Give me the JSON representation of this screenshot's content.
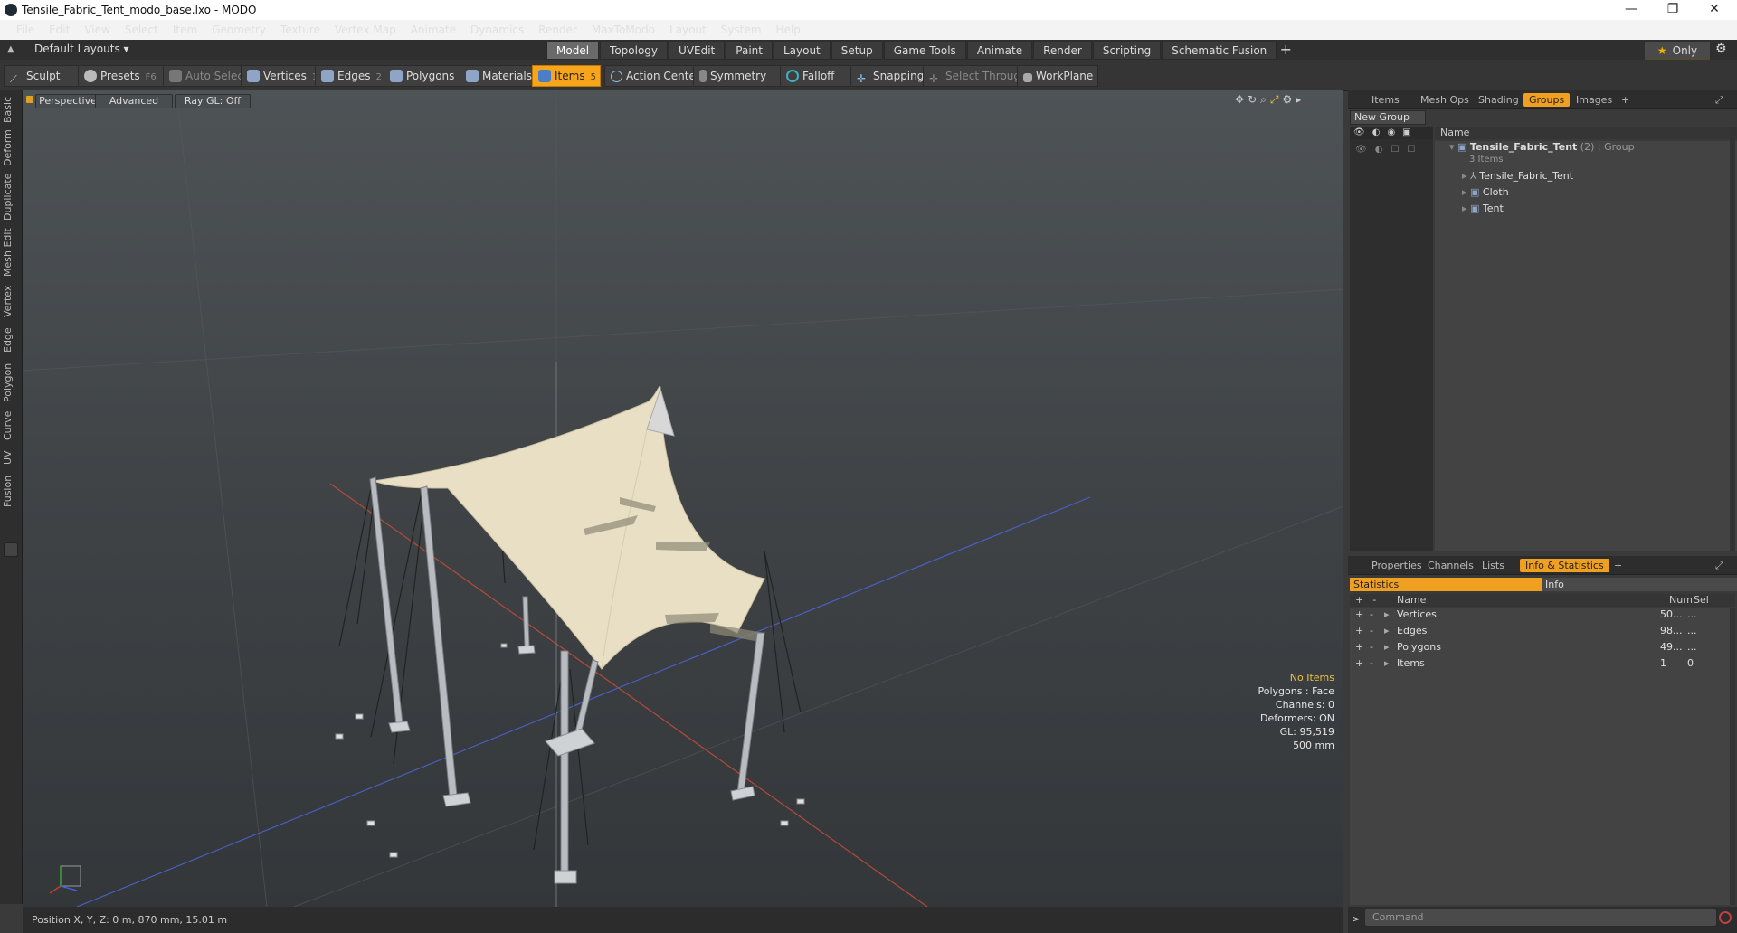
{
  "window": {
    "title": "Tensile_Fabric_Tent_modo_base.lxo - MODO",
    "controls": [
      "—",
      "❐",
      "✕"
    ]
  },
  "menu": [
    "File",
    "Edit",
    "View",
    "Select",
    "Item",
    "Geometry",
    "Texture",
    "Vertex Map",
    "Animate",
    "Dynamics",
    "Render",
    "MaxToModo",
    "Layout",
    "System",
    "Help"
  ],
  "layouts": {
    "label": "Default Layouts ▾",
    "tabs": [
      "Model",
      "Topology",
      "UVEdit",
      "Paint",
      "Layout",
      "Setup",
      "Game Tools",
      "Animate",
      "Render",
      "Scripting",
      "Schematic Fusion"
    ],
    "active_tab": "Model",
    "add": "+",
    "only": "Only"
  },
  "toolbar": {
    "sculpt": "Sculpt",
    "presets": "Presets",
    "presets_key": "F6",
    "auto_select": "Auto Select",
    "vertices": "Vertices",
    "vertices_key": "1",
    "edges": "Edges",
    "edges_key": "2",
    "polygons": "Polygons",
    "materials": "Materials",
    "items": "Items",
    "items_key": "5",
    "action_center": "Action Center",
    "symmetry": "Symmetry",
    "falloff": "Falloff",
    "snapping": "Snapping",
    "select_through": "Select Through",
    "workplane": "WorkPlane"
  },
  "left_tabs": [
    "Basic",
    "Deform",
    "Duplicate",
    "Mesh Edit",
    "Vertex",
    "Edge",
    "Polygon",
    "Curve",
    "UV",
    "Fusion"
  ],
  "viewport": {
    "view": "Perspective",
    "shading": "Advanced",
    "raygl": "Ray GL: Off",
    "hud": {
      "selection": "No Items",
      "polygons": "Polygons : Face",
      "channels": "Channels: 0",
      "deformers": "Deformers: ON",
      "gl": "GL: 95,519",
      "scale": "500 mm"
    }
  },
  "status": {
    "position": "Position X, Y, Z:  0 m, 870 mm, 15.01 m"
  },
  "groups_panel": {
    "tabs": [
      "Items",
      "Mesh Ops",
      "Shading",
      "Groups",
      "Images"
    ],
    "active_tab": "Groups",
    "add": "+",
    "new_group": "New Group",
    "name_header": "Name",
    "group": {
      "name": "Tensile_Fabric_Tent",
      "count": "(2)",
      "kind": ": Group",
      "sub": "3 Items"
    },
    "children": [
      "Tensile_Fabric_Tent",
      "Cloth",
      "Tent"
    ]
  },
  "stats_panel": {
    "tabs": [
      "Properties",
      "Channels",
      "Lists",
      "Info & Statistics"
    ],
    "active_tab": "Info & Statistics",
    "add": "+",
    "subtabs": [
      "Statistics",
      "Info"
    ],
    "headers": {
      "name": "Name",
      "num": "Num",
      "sel": "Sel"
    },
    "rows": [
      {
        "name": "Vertices",
        "num": "50...",
        "sel": "..."
      },
      {
        "name": "Edges",
        "num": "98...",
        "sel": "..."
      },
      {
        "name": "Polygons",
        "num": "49...",
        "sel": "..."
      },
      {
        "name": "Items",
        "num": "1",
        "sel": "0"
      }
    ]
  },
  "command": {
    "prompt": ">",
    "placeholder": "Command"
  }
}
